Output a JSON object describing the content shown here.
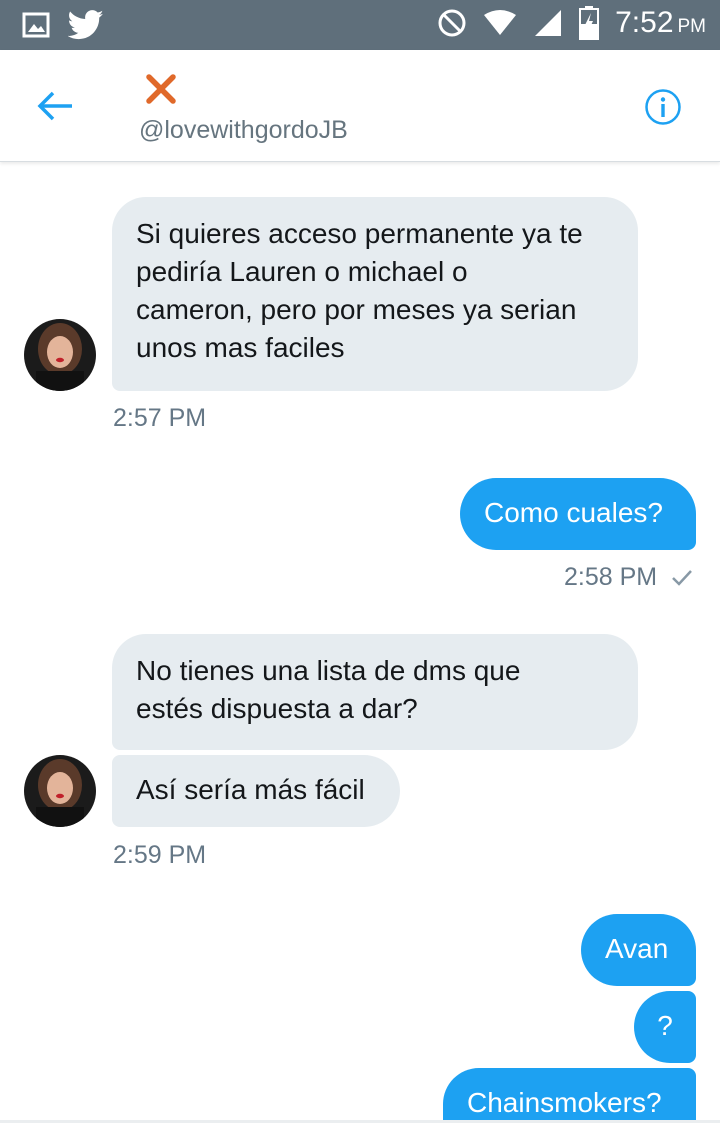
{
  "status_bar": {
    "time": "7:52",
    "ampm": "PM",
    "icons": [
      "image-icon",
      "twitter-icon",
      "do-not-disturb-icon",
      "wifi-icon",
      "signal-icon",
      "battery-icon"
    ]
  },
  "header": {
    "handle": "@lovewithgordoJB",
    "accent_color": "#1da1f2",
    "name_mark_color": "#e0692a"
  },
  "messages": {
    "m1": {
      "lines": [
        "Si quieres acceso permanente ya te",
        "pediría Lauren o michael o",
        "cameron, pero por meses ya serian",
        "unos mas faciles"
      ],
      "time": "2:57 PM"
    },
    "m2": {
      "text": "Como cuales?",
      "time": "2:58 PM"
    },
    "m3": {
      "lines": [
        "No tienes una lista de dms que",
        "estés dispuesta a dar?"
      ]
    },
    "m4": {
      "text": "Así sería más fácil",
      "time": "2:59 PM"
    },
    "m5": {
      "text": "Avan"
    },
    "m6": {
      "text": "?"
    },
    "m7": {
      "text": "Chainsmokers?"
    }
  },
  "colors": {
    "incoming_bubble": "#e6ecf0",
    "outgoing_bubble": "#1da1f2",
    "status_bar": "#5f6f7b"
  }
}
